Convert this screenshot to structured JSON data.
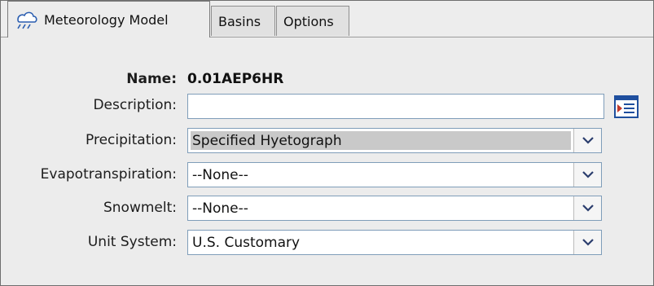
{
  "tabs": [
    {
      "label": "Meteorology Model",
      "icon": "meteorology-icon"
    },
    {
      "label": "Basins"
    },
    {
      "label": "Options"
    }
  ],
  "form": {
    "name_label": "Name:",
    "name_value": "0.01AEP6HR",
    "description_label": "Description:",
    "description_value": "",
    "precipitation_label": "Precipitation:",
    "precipitation_value": "Specified Hyetograph",
    "evapotranspiration_label": "Evapotranspiration:",
    "evapotranspiration_value": "--None--",
    "snowmelt_label": "Snowmelt:",
    "snowmelt_value": "--None--",
    "unit_system_label": "Unit System:",
    "unit_system_value": "U.S. Customary"
  },
  "icons": {
    "description_editor": "edit-description-icon",
    "dropdown": "chevron-down-icon"
  },
  "colors": {
    "panel_bg": "#ececec",
    "field_border": "#7f9db9",
    "selection_bg": "#c9c9c9",
    "icon_blue": "#1f4f9e"
  }
}
